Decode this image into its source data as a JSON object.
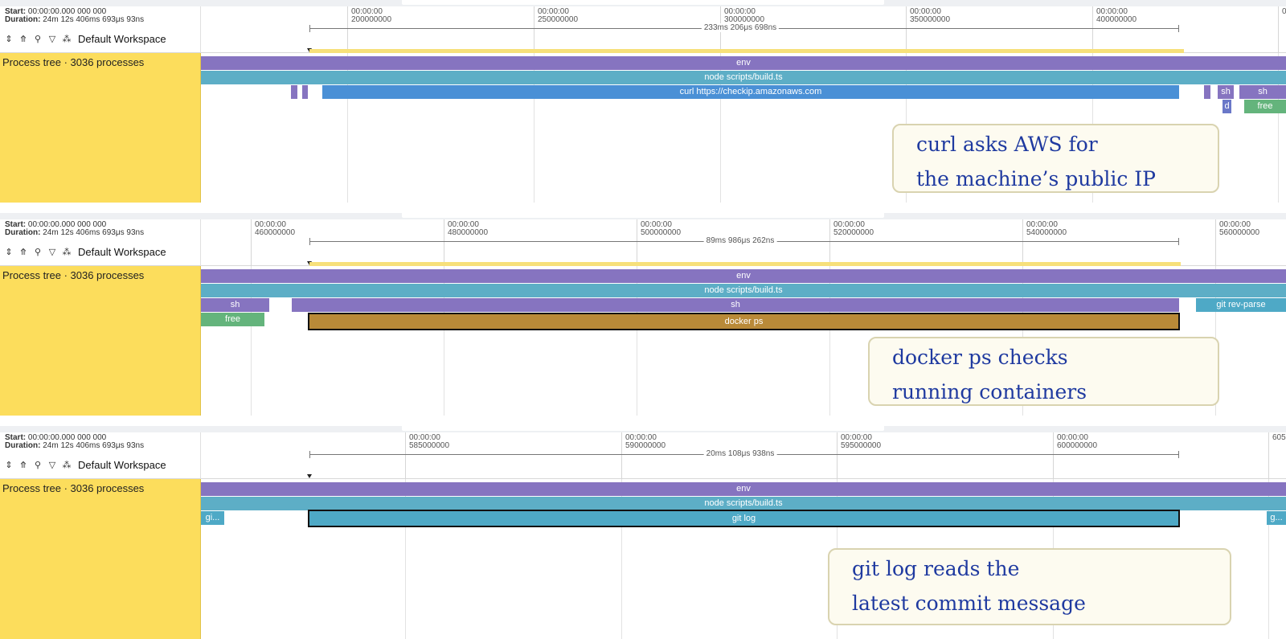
{
  "panels": [
    {
      "meta": {
        "start_label": "Start:",
        "start_value": "00:00:00.000 000 000",
        "duration_label": "Duration:",
        "duration_value": "24m 12s 406ms 693μs 93ns"
      },
      "workspace": "Default Workspace",
      "ticks": [
        {
          "time": "00:00:00",
          "value": "200000000"
        },
        {
          "time": "00:00:00",
          "value": "250000000"
        },
        {
          "time": "00:00:00",
          "value": "300000000"
        },
        {
          "time": "00:00:00",
          "value": "350000000"
        },
        {
          "time": "00:00:00",
          "value": "400000000"
        },
        {
          "time": "0",
          "value": ""
        }
      ],
      "span": "233ms 206μs 698ns",
      "process_title": "Process tree · 3036 processes",
      "slices": [
        {
          "label": "env",
          "color": "purple"
        },
        {
          "label": "node scripts/build.ts",
          "color": "teal"
        },
        {
          "label": "curl https://checkip.amazonaws.com",
          "color": "blue"
        },
        {
          "label": "sh",
          "color": "purple"
        },
        {
          "label": "sh",
          "color": "purple"
        },
        {
          "label": "d",
          "color": "indigo"
        },
        {
          "label": "free",
          "color": "green"
        }
      ],
      "note": [
        "curl asks AWS for",
        "the machine’s public IP"
      ]
    },
    {
      "meta": {
        "start_label": "Start:",
        "start_value": "00:00:00.000 000 000",
        "duration_label": "Duration:",
        "duration_value": "24m 12s 406ms 693μs 93ns"
      },
      "workspace": "Default Workspace",
      "ticks": [
        {
          "time": "00:00:00",
          "value": "460000000"
        },
        {
          "time": "00:00:00",
          "value": "480000000"
        },
        {
          "time": "00:00:00",
          "value": "500000000"
        },
        {
          "time": "00:00:00",
          "value": "520000000"
        },
        {
          "time": "00:00:00",
          "value": "540000000"
        },
        {
          "time": "00:00:00",
          "value": "560000000"
        }
      ],
      "span": "89ms 986μs 262ns",
      "process_title": "Process tree · 3036 processes",
      "slices": [
        {
          "label": "env",
          "color": "purple"
        },
        {
          "label": "node scripts/build.ts",
          "color": "teal"
        },
        {
          "label": "sh",
          "color": "purple"
        },
        {
          "label": "sh",
          "color": "purple"
        },
        {
          "label": "git rev-parse",
          "color": "teal"
        },
        {
          "label": "free",
          "color": "green"
        },
        {
          "label": "docker ps",
          "color": "brown",
          "selected": true
        }
      ],
      "note": [
        "docker ps checks",
        "running containers"
      ]
    },
    {
      "meta": {
        "start_label": "Start:",
        "start_value": "00:00:00.000 000 000",
        "duration_label": "Duration:",
        "duration_value": "24m 12s 406ms 693μs 93ns"
      },
      "workspace": "Default Workspace",
      "ticks": [
        {
          "time": "00:00:00",
          "value": "585000000"
        },
        {
          "time": "00:00:00",
          "value": "590000000"
        },
        {
          "time": "00:00:00",
          "value": "595000000"
        },
        {
          "time": "00:00:00",
          "value": "600000000"
        },
        {
          "time": "",
          "value": "605"
        }
      ],
      "span": "20ms 108μs 938ns",
      "process_title": "Process tree · 3036 processes",
      "slices": [
        {
          "label": "env",
          "color": "purple"
        },
        {
          "label": "node scripts/build.ts",
          "color": "teal"
        },
        {
          "label": "gi...",
          "color": "teal"
        },
        {
          "label": "git log",
          "color": "teal",
          "selected": true
        },
        {
          "label": "g...",
          "color": "teal"
        }
      ],
      "note": [
        "git log reads the",
        "latest commit message"
      ]
    }
  ]
}
